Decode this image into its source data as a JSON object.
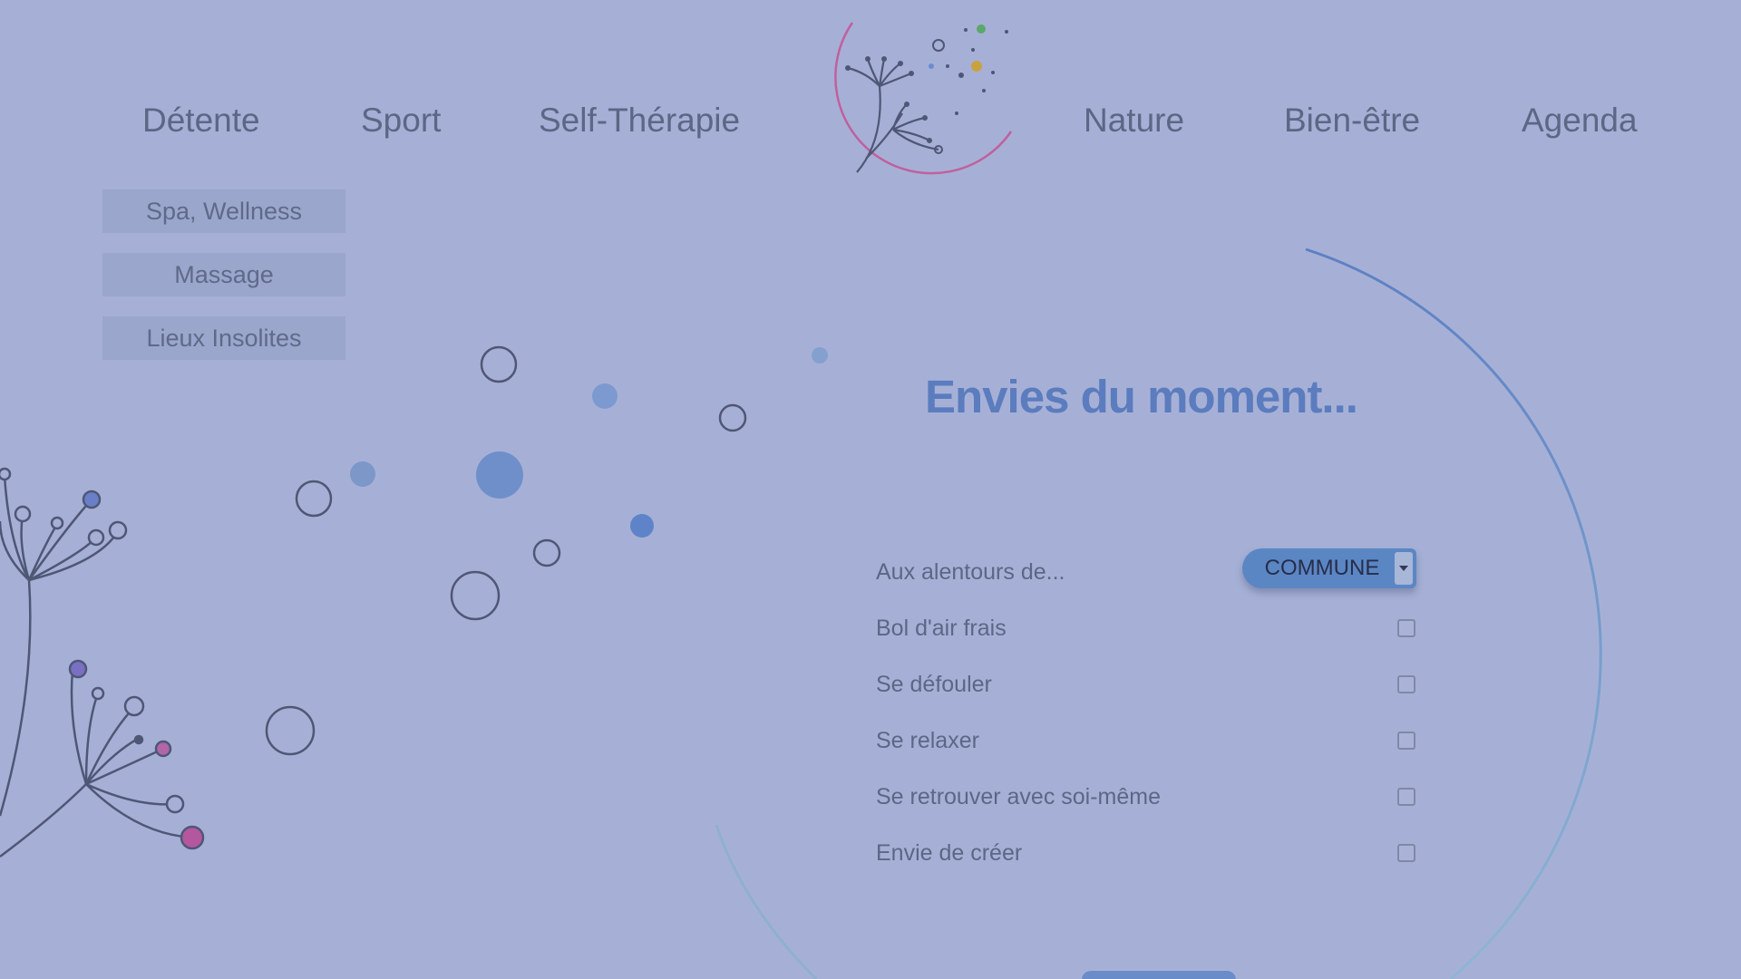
{
  "nav": {
    "items": [
      {
        "label": "Détente"
      },
      {
        "label": "Sport"
      },
      {
        "label": "Self-Thérapie"
      },
      {
        "label": "Nature"
      },
      {
        "label": "Bien-être"
      },
      {
        "label": "Agenda"
      }
    ]
  },
  "submenu": {
    "items": [
      {
        "label": "Spa, Wellness"
      },
      {
        "label": "Massage"
      },
      {
        "label": "Lieux Insolites"
      }
    ]
  },
  "main": {
    "title": "Envies du moment...",
    "location": {
      "label": "Aux alentours de...",
      "selected": "COMMUNE"
    },
    "options": [
      {
        "label": "Bol d'air frais",
        "checked": false
      },
      {
        "label": "Se défouler",
        "checked": false
      },
      {
        "label": "Se relaxer",
        "checked": false
      },
      {
        "label": "Se retrouver avec soi-même",
        "checked": false
      },
      {
        "label": "Envie de créer",
        "checked": false
      }
    ]
  },
  "colors": {
    "background": "#a6b0d6",
    "accent": "#5b7cbe",
    "select_bg": "#5b86c4",
    "logo_ring": "#c0609e"
  },
  "icons": {
    "logo": "dandelion-logo-icon",
    "select_arrow": "chevron-down-icon"
  }
}
